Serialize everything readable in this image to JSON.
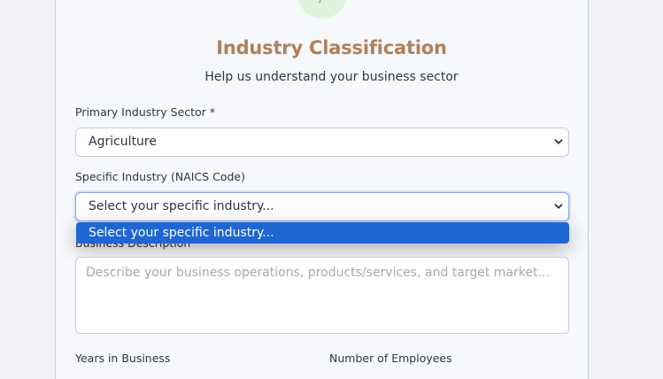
{
  "header": {
    "title": "Industry Classification",
    "subtitle": "Help us understand your business sector"
  },
  "form": {
    "primary_industry": {
      "label": "Primary Industry Sector *",
      "value": "Agriculture"
    },
    "specific_industry": {
      "label": "Specific Industry (NAICS Code)",
      "value": "Select your specific industry...",
      "options": [
        "Select your specific industry..."
      ]
    },
    "business_description": {
      "label": "Business Description",
      "placeholder": "Describe your business operations, products/services, and target market..."
    },
    "years_in_business": {
      "label": "Years in Business"
    },
    "number_of_employees": {
      "label": "Number of Employees"
    }
  },
  "colors": {
    "title": "#b0805b",
    "dropdown_highlight": "#1e66d2",
    "step_circle": "#ddf5df"
  },
  "icons": {
    "select_chevron": "chevron-down-icon"
  }
}
